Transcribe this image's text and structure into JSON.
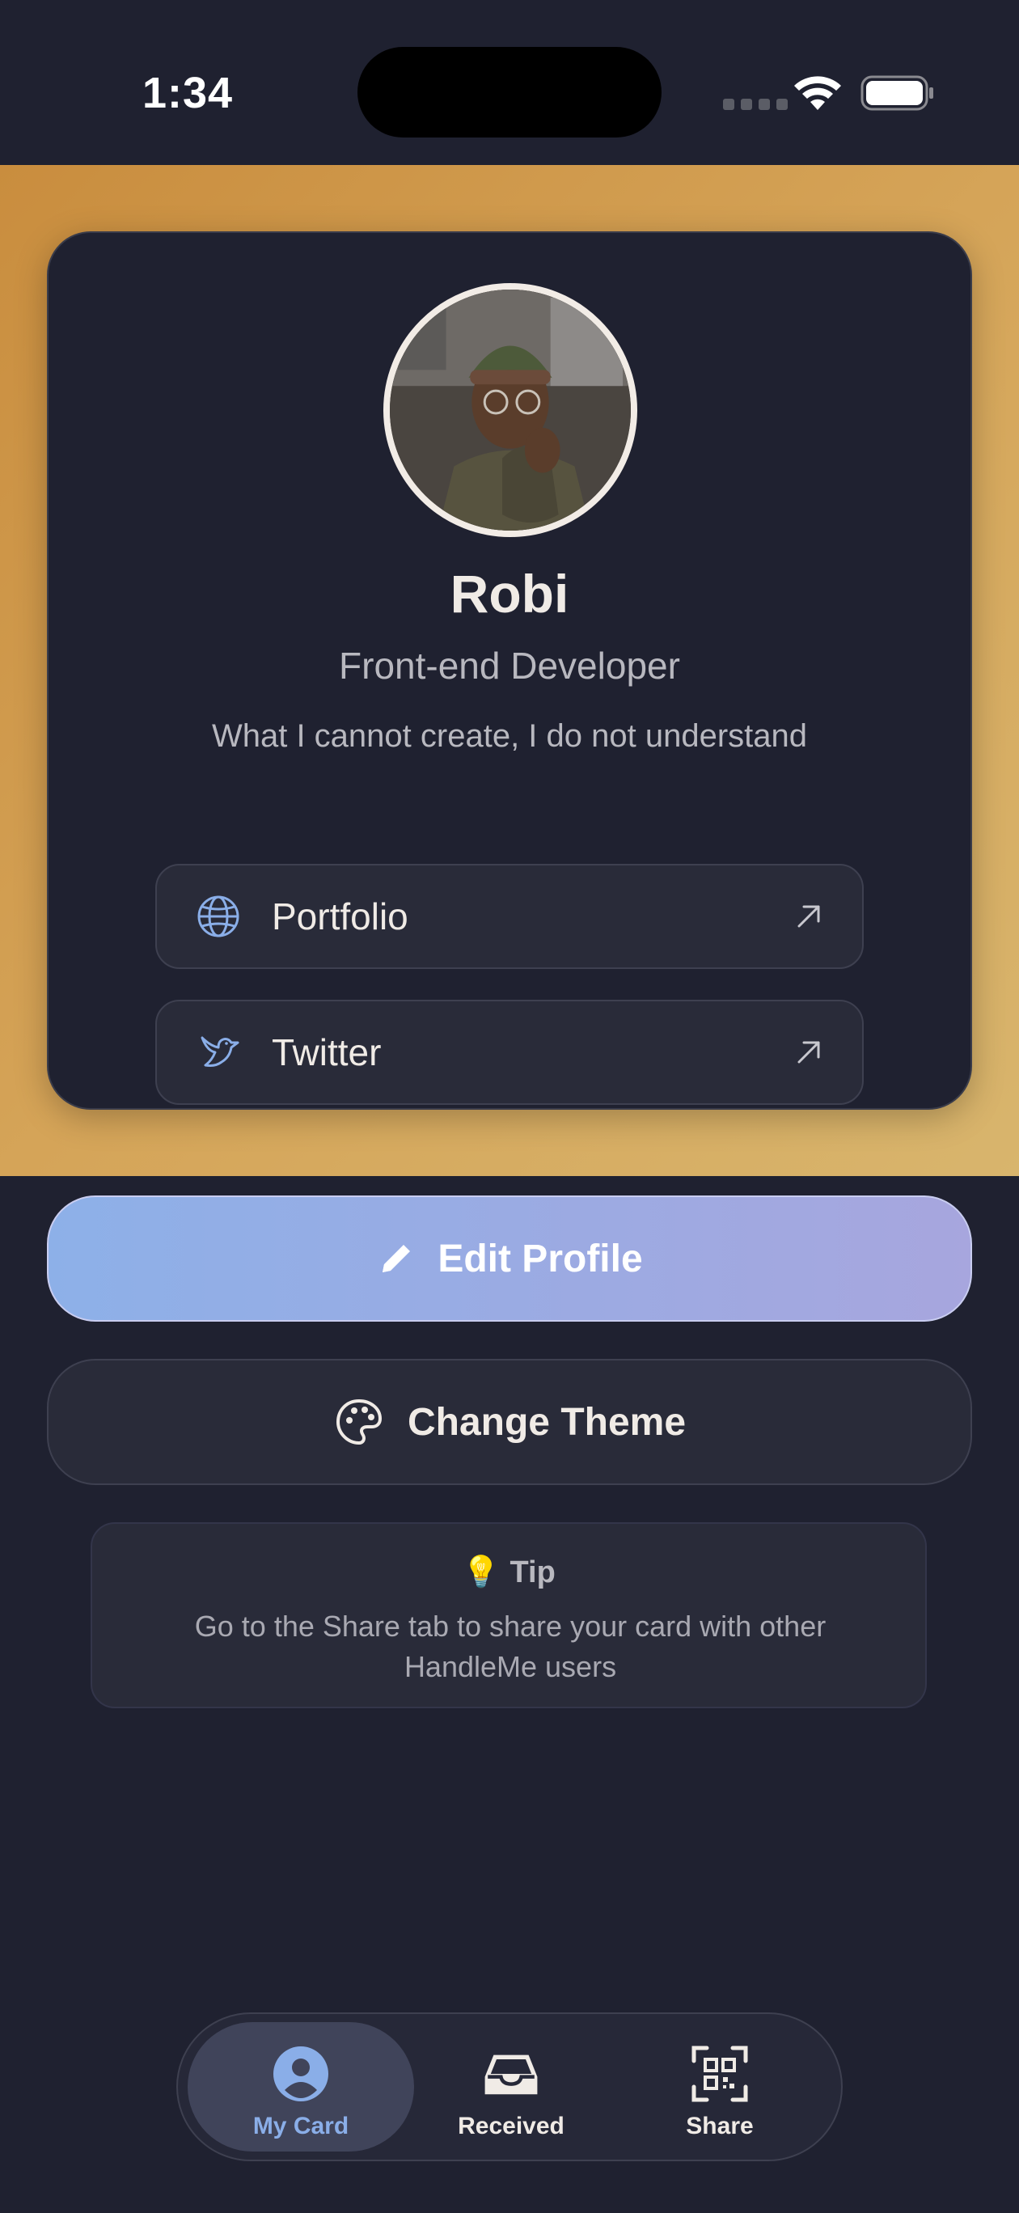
{
  "status_bar": {
    "time": "1:34"
  },
  "profile": {
    "name": "Robi",
    "title": "Front-end Developer",
    "bio": "What I cannot create, I do not understand"
  },
  "links": [
    {
      "label": "Portfolio",
      "icon": "globe-icon"
    },
    {
      "label": "Twitter",
      "icon": "bird-icon"
    }
  ],
  "actions": {
    "edit_label": "Edit Profile",
    "theme_label": "Change Theme"
  },
  "tip": {
    "heading": "Tip",
    "bulb": "💡",
    "text": "Go to the Share tab to share your card with other HandleMe users"
  },
  "tabs": [
    {
      "label": "My Card",
      "icon": "person-icon",
      "active": true
    },
    {
      "label": "Received",
      "icon": "inbox-icon",
      "active": false
    },
    {
      "label": "Share",
      "icon": "qr-code-icon",
      "active": false
    }
  ],
  "colors": {
    "background": "#1f2130",
    "hero_gold": "#d5a458",
    "accent_blue": "#8aaee8",
    "accent_violet": "#a7a6de"
  }
}
